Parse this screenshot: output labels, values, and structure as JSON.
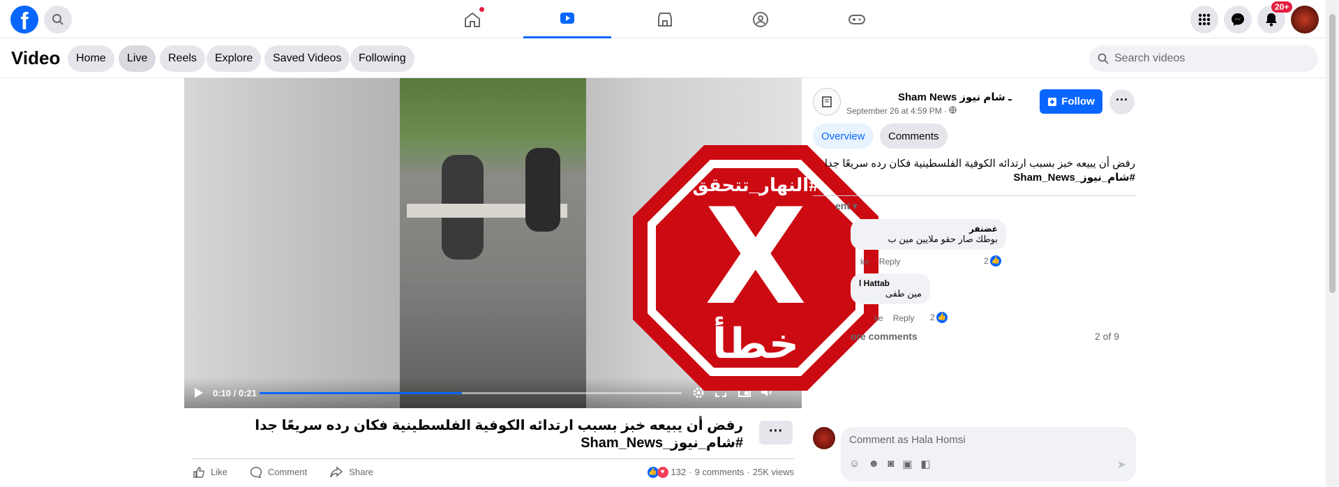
{
  "topbar": {
    "logo_glyph": "f",
    "notifications_badge": "20+"
  },
  "subbar": {
    "title": "Video",
    "pills": [
      "Home",
      "Live",
      "Reels",
      "Explore",
      "Saved Videos",
      "Following"
    ],
    "search_placeholder": "Search videos"
  },
  "player": {
    "time": "0:10 / 0:21",
    "progress": 0.48
  },
  "overlay": {
    "hashtag": "#النهار_تتحقق",
    "mark": "X",
    "verdict": "خطأ"
  },
  "post": {
    "page_name": "Sham News ـ شام نيوز",
    "time": "September 26 at 4:59 PM · ",
    "follow_label": "Follow",
    "tab_overview": "Overview",
    "tab_comments": "Comments",
    "text_line1": "رفض أن يبيعه خبز بسبب ارتدائه الكوفية الفلسطينية فكان رده سريعًا جدا",
    "text_line2": "#شام_نيوز_Sham_News",
    "sort_label": "ent",
    "comments": [
      {
        "author": "غضنفر",
        "text": "بوطك صار حقو ملايين مين ب",
        "like": "ke",
        "reply": "Reply",
        "count": "2"
      },
      {
        "author": "l Hattab",
        "text": "مين طفى",
        "like": "ke",
        "reply": "Reply",
        "count": "2"
      }
    ],
    "view_more": "ore comments",
    "pager": "2 of 9",
    "compose_placeholder": "Comment as Hala Homsi"
  },
  "caption": {
    "line1": "رفض أن يبيعه خبز بسبب ارتدائه الكوفية الفلسطينية فكان رده سريعًا جدا",
    "line2": "#شام_نيوز_Sham_News"
  },
  "actions": {
    "like": "Like",
    "comment": "Comment",
    "share": "Share",
    "reaction_count": "132",
    "comments_count": "9 comments",
    "views": "25K views"
  },
  "colors": {
    "accent": "#0866ff",
    "stop_red": "#cc0a12"
  }
}
